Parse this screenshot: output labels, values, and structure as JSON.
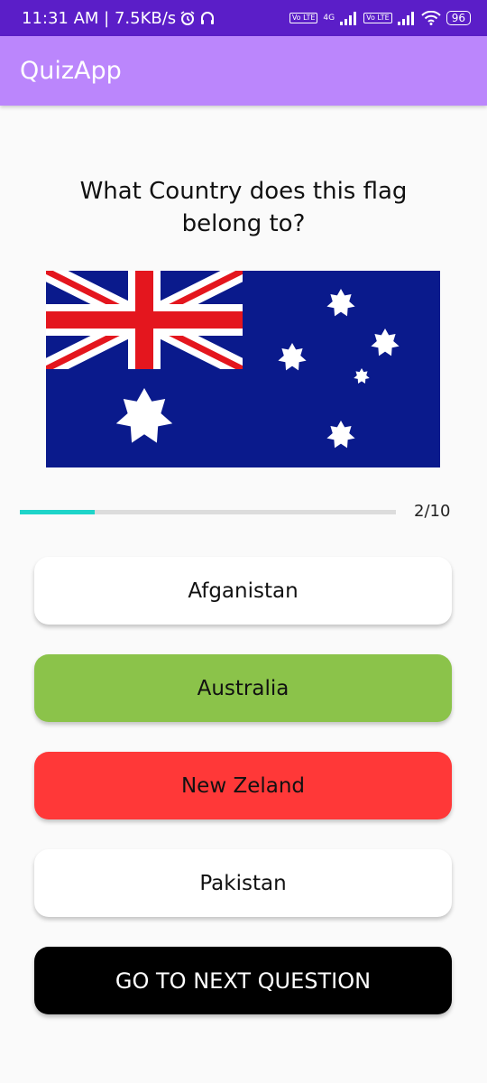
{
  "status_bar": {
    "time_speed": "11:31 AM | 7.5KB/s",
    "network_type": "4G",
    "lte_label": "Vo LTE",
    "battery": "96",
    "icons": [
      "alarm-icon",
      "headphones-icon",
      "signal-icon",
      "wifi-icon",
      "battery-icon"
    ]
  },
  "app_bar": {
    "title": "QuizApp"
  },
  "question": {
    "text": "What Country does this flag belong to?"
  },
  "flag": {
    "icon": "australia-flag"
  },
  "progress": {
    "current": 2,
    "total": 10,
    "label": "2/10"
  },
  "options": [
    {
      "label": "Afganistan",
      "bg": "#ffffff",
      "text_color": "#111111"
    },
    {
      "label": "Australia",
      "bg": "#8bc34a",
      "text_color": "#111111"
    },
    {
      "label": "New Zeland",
      "bg": "#ff3838",
      "text_color": "#111111"
    },
    {
      "label": "Pakistan",
      "bg": "#ffffff",
      "text_color": "#111111"
    }
  ],
  "next_button": {
    "label": "GO TO NEXT QUESTION"
  },
  "colors": {
    "status_bar": "#5b1ec8",
    "app_bar": "#bb86fc",
    "progress_fill": "#1ed4c9",
    "correct": "#8bc34a",
    "wrong": "#ff3838"
  }
}
